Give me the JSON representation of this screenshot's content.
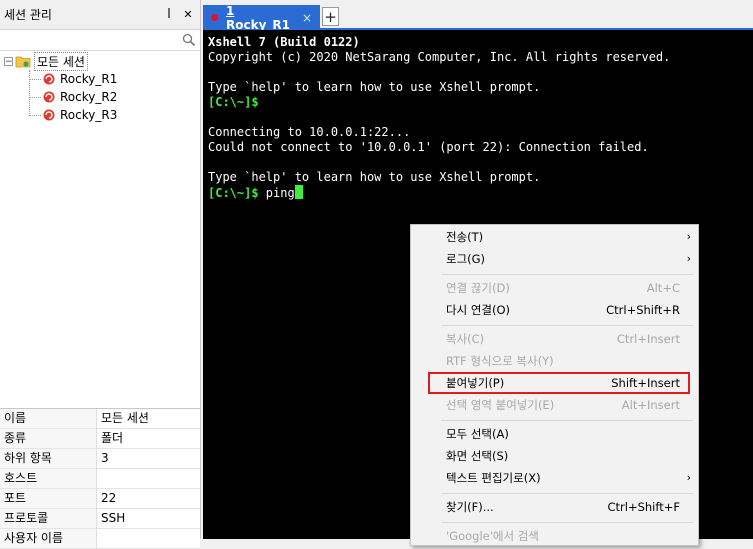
{
  "session_panel": {
    "title": "세션 관리",
    "pin_glyph": "ꟾ",
    "close_glyph": "✕",
    "search": {
      "value": "",
      "placeholder": ""
    },
    "tree": {
      "expander": "−",
      "root_label": "모든 세션",
      "sessions": [
        "Rocky_R1",
        "Rocky_R2",
        "Rocky_R3"
      ]
    },
    "properties": [
      {
        "key": "이름",
        "value": "모든 세션"
      },
      {
        "key": "종류",
        "value": "폴더"
      },
      {
        "key": "하위 항목",
        "value": "3"
      },
      {
        "key": "호스트",
        "value": ""
      },
      {
        "key": "포트",
        "value": "22"
      },
      {
        "key": "프로토콜",
        "value": "SSH"
      },
      {
        "key": "사용자 이름",
        "value": ""
      }
    ]
  },
  "tabs": {
    "active_label": "1 Rocky_R1",
    "close_glyph": "×",
    "add_glyph": "+",
    "status_color": "#e81123",
    "accent_color": "#2b6cd4"
  },
  "terminal": {
    "banner_title": "Xshell 7 (Build 0122)",
    "copyright": "Copyright (c) 2020 NetSarang Computer, Inc. All rights reserved.",
    "help_line_1": "Type `help' to learn how to use Xshell prompt.",
    "prompt_1": "[C:\\~]$",
    "connecting": "Connecting to 10.0.0.1:22...",
    "failed": "Could not connect to '10.0.0.1' (port 22): Connection failed.",
    "help_line_2": "Type `help' to learn how to use Xshell prompt.",
    "prompt_2": "[C:\\~]$",
    "typed_command": " ping",
    "prompt_color": "#3df03d"
  },
  "context_menu": {
    "items": [
      {
        "label": "전송(T)",
        "shortcut": "",
        "submenu": true,
        "disabled": false
      },
      {
        "label": "로그(G)",
        "shortcut": "",
        "submenu": true,
        "disabled": false
      },
      {
        "label": "연결 끊기(D)",
        "shortcut": "Alt+C",
        "submenu": false,
        "disabled": true
      },
      {
        "label": "다시 연결(O)",
        "shortcut": "Ctrl+Shift+R",
        "submenu": false,
        "disabled": false
      },
      {
        "label": "복사(C)",
        "shortcut": "Ctrl+Insert",
        "submenu": false,
        "disabled": true
      },
      {
        "label": "RTF 형식으로 복사(Y)",
        "shortcut": "",
        "submenu": false,
        "disabled": true
      },
      {
        "label": "붙여넣기(P)",
        "shortcut": "Shift+Insert",
        "submenu": false,
        "disabled": false,
        "highlighted": true
      },
      {
        "label": "선택 영역 붙여넣기(E)",
        "shortcut": "Alt+Insert",
        "submenu": false,
        "disabled": true
      },
      {
        "label": "모두 선택(A)",
        "shortcut": "",
        "submenu": false,
        "disabled": false
      },
      {
        "label": "화면 선택(S)",
        "shortcut": "",
        "submenu": false,
        "disabled": false
      },
      {
        "label": "텍스트 편집기로(X)",
        "shortcut": "",
        "submenu": true,
        "disabled": false
      },
      {
        "label": "찾기(F)...",
        "shortcut": "Ctrl+Shift+F",
        "submenu": false,
        "disabled": false
      },
      {
        "label": "'Google'에서 검색",
        "shortcut": "",
        "submenu": false,
        "disabled": true
      }
    ],
    "submenu_glyph": "›",
    "highlight_color": "#e41a1a"
  }
}
